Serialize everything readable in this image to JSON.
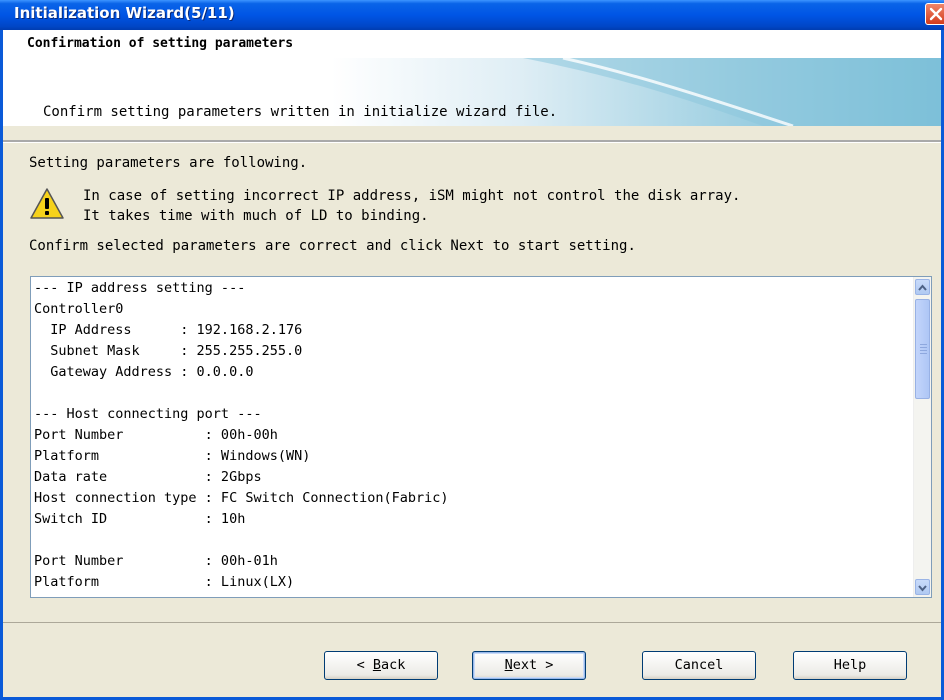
{
  "window": {
    "title": "Initialization Wizard(5/11)"
  },
  "header": {
    "heading": "Confirmation of setting parameters",
    "subheading": "Confirm setting parameters written in initialize wizard file."
  },
  "body": {
    "intro": "Setting parameters are following.",
    "warning_line1": "In case of setting incorrect IP address, iSM might not control the disk array.",
    "warning_line2": "It takes time with much of LD to binding.",
    "confirm": "Confirm selected parameters are correct and click Next to start setting."
  },
  "parameters": {
    "lines": [
      "--- IP address setting ---",
      "Controller0",
      "  IP Address      : 192.168.2.176",
      "  Subnet Mask     : 255.255.255.0",
      "  Gateway Address : 0.0.0.0",
      "",
      "--- Host connecting port ---",
      "Port Number          : 00h-00h",
      "Platform             : Windows(WN)",
      "Data rate            : 2Gbps",
      "Host connection type : FC Switch Connection(Fabric)",
      "Switch ID            : 10h",
      "",
      "Port Number          : 00h-01h",
      "Platform             : Linux(LX)"
    ]
  },
  "buttons": {
    "back_prefix": "< ",
    "back_key": "B",
    "back_rest": "ack",
    "next_key": "N",
    "next_rest": "ext >",
    "cancel": "Cancel",
    "help": "Help"
  },
  "colors": {
    "titlebar": "#0055e5",
    "close": "#d33b1b",
    "dialog_bg": "#ece9d8"
  }
}
